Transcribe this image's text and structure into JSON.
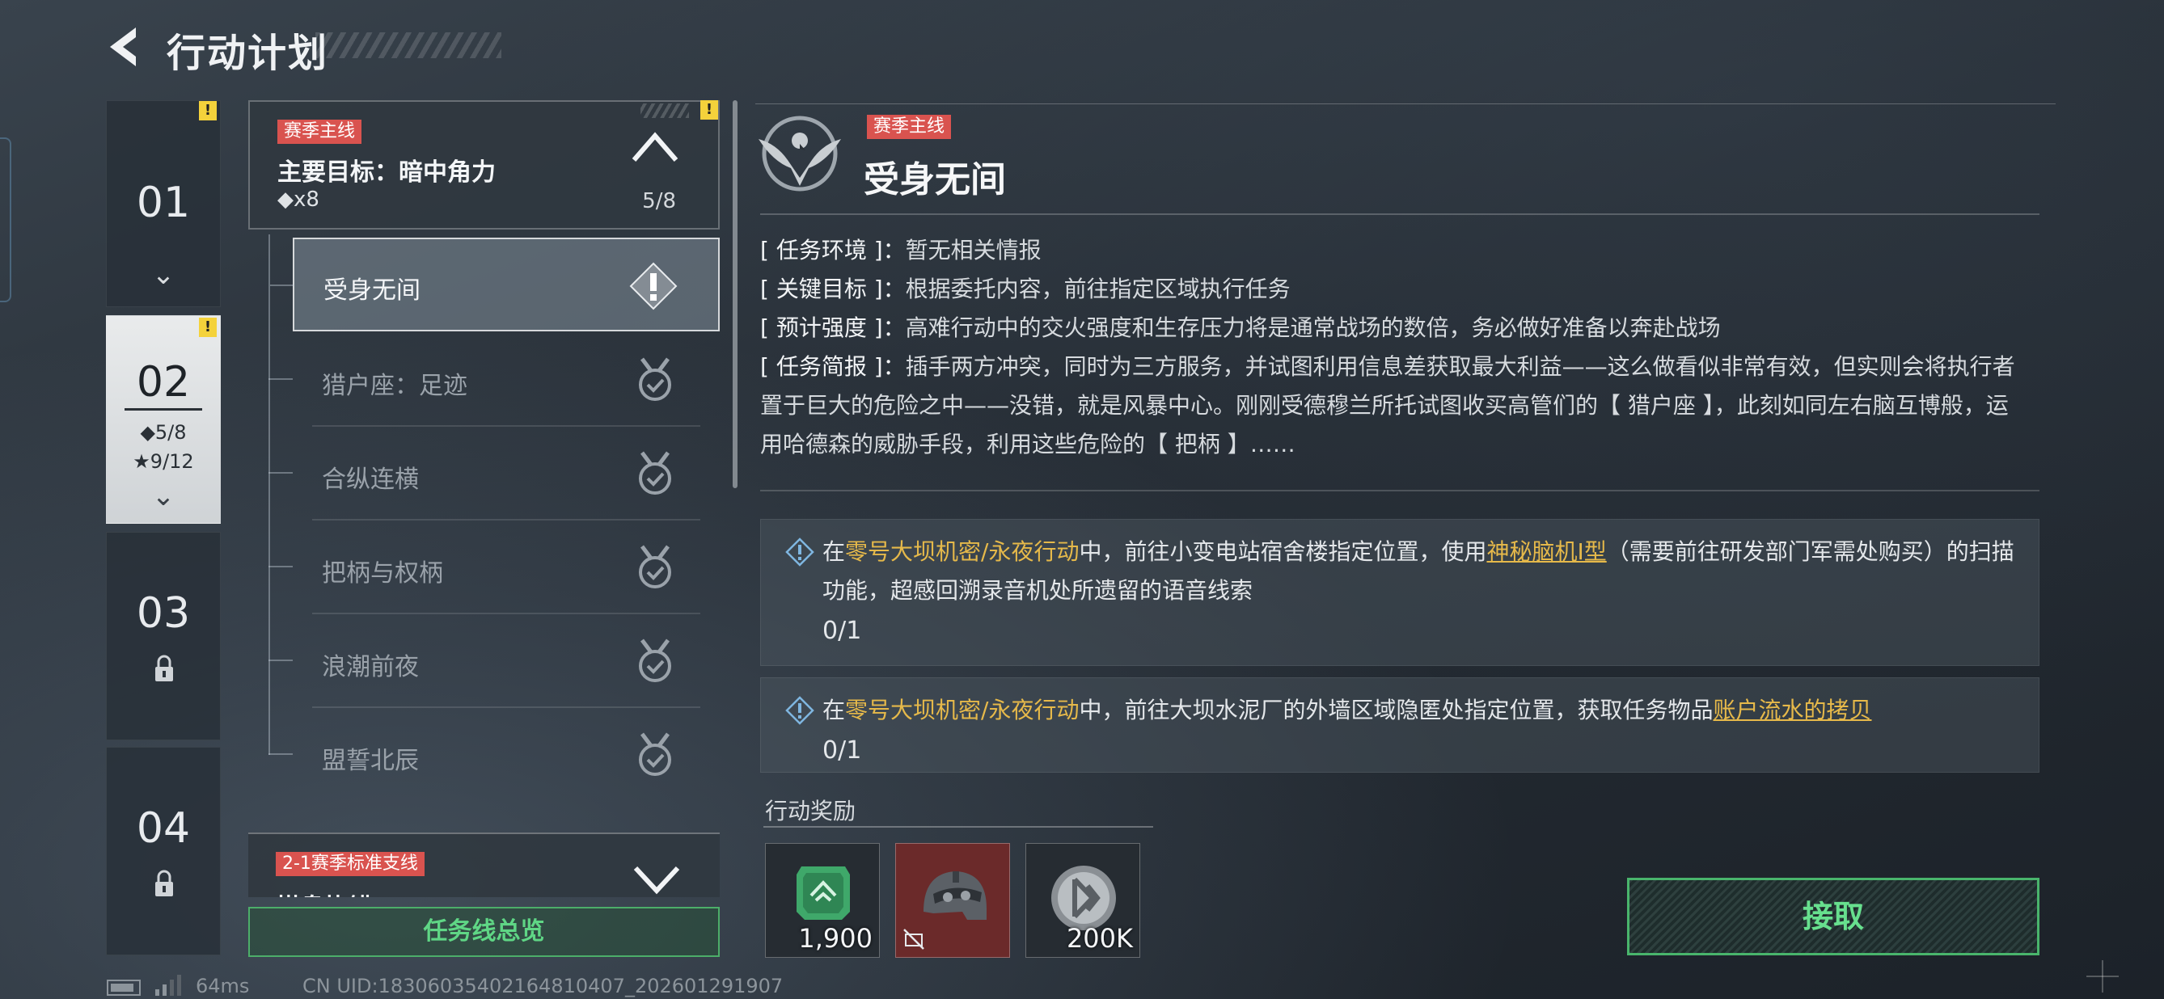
{
  "header": {
    "title": "行动计划"
  },
  "chapters": [
    {
      "num": "01",
      "warn": "!",
      "chevron": "⌄"
    },
    {
      "num": "02",
      "warn": "!",
      "stat_diamond": "◆5/8",
      "stat_star": "★9/12",
      "chevron": "⌄"
    },
    {
      "num": "03",
      "locked": true
    },
    {
      "num": "04",
      "locked": true
    }
  ],
  "main_mission": {
    "tag": "赛季主线",
    "title": "主要目标：暗中角力",
    "sub": "◆x8",
    "progress": "5/8",
    "warn": "!"
  },
  "sub_missions": [
    {
      "label": "受身无间",
      "state": "active"
    },
    {
      "label": "猎户座：足迹",
      "state": "done"
    },
    {
      "label": "合纵连横",
      "state": "done"
    },
    {
      "label": "把柄与权柄",
      "state": "done"
    },
    {
      "label": "浪潮前夜",
      "state": "done"
    },
    {
      "label": "盟誓北辰",
      "state": "done"
    }
  ],
  "branch_mission": {
    "tag": "2-1赛季标准支线",
    "title": "棋盘执错"
  },
  "overview_button": "任务线总览",
  "detail": {
    "tag": "赛季主线",
    "title": "受身无间",
    "info": [
      {
        "key": "[ 任务环境 ]",
        "value": "暂无相关情报"
      },
      {
        "key": "[ 关键目标 ]",
        "value": "根据委托内容，前往指定区域执行任务"
      },
      {
        "key": "[ 预计强度 ]",
        "value": "高难行动中的交火强度和生存压力将是通常战场的数倍，务必做好准备以奔赴战场"
      }
    ],
    "brief_key": "[ 任务简报 ]",
    "brief_value": "插手两方冲突，同时为三方服务，并试图利用信息差获取最大利益——这么做看似非常有效，但实则会将执行者置于巨大的危险之中——没错，就是风暴中心。刚刚受德穆兰所托试图收买高管们的【 猎户座 】，此刻如同左右脑互博般，运用哈德森的威胁手段，利用这些危险的【 把柄 】……",
    "objectives": [
      {
        "pre": "在",
        "mode": "零号大坝机密/永夜行动",
        "mid": "中，前往小变电站宿舍楼指定位置，使用",
        "item": "神秘脑机Ⅰ型",
        "post": "（需要前往研发部门军需处购买）的扫描功能，超感回溯录音机处所遗留的语音线索",
        "count": "0/1"
      },
      {
        "pre": "在",
        "mode": "零号大坝机密/永夜行动",
        "mid": "中，前往大坝水泥厂的外墙区域隐匿处指定位置，获取任务物品",
        "item": "账户流水的拷贝",
        "post": "",
        "count": "0/1"
      }
    ],
    "reward_label": "行动奖励",
    "rewards": [
      {
        "icon": "exp-badge-icon",
        "qty": "1,900",
        "color": "#3fa86a"
      },
      {
        "icon": "helmet-icon",
        "qty": "",
        "color": "#a33b3b"
      },
      {
        "icon": "coin-icon",
        "qty": "200K",
        "color": "#8a8f94"
      }
    ],
    "accept_button": "接取"
  },
  "footer": {
    "ping": "64ms",
    "uid": "CN UID:18306035402164810407_202601291907"
  },
  "colors": {
    "accent_green": "#4cae69",
    "tag_red": "#d9534f",
    "highlight_yellow": "#e6b94a",
    "warn_yellow": "#f4d23b"
  }
}
